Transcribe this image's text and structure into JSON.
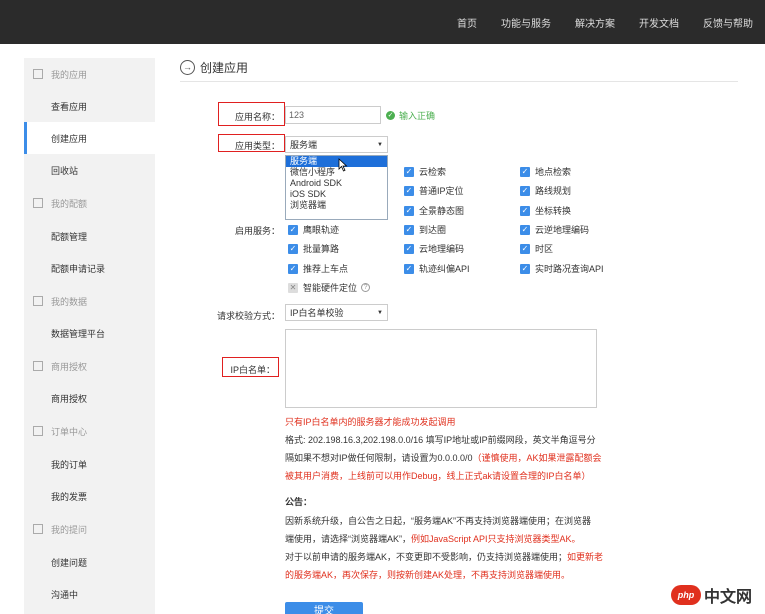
{
  "nav": {
    "items": [
      "首页",
      "功能与服务",
      "解决方案",
      "开发文档",
      "反馈与帮助"
    ]
  },
  "sidebar": {
    "sections": [
      {
        "head": "我的应用",
        "icon": "grid-icon",
        "items": [
          "查看应用",
          "创建应用",
          "回收站"
        ]
      },
      {
        "head": "我的配额",
        "icon": "list-icon",
        "items": [
          "配额管理",
          "配额申请记录"
        ]
      },
      {
        "head": "我的数据",
        "icon": "db-icon",
        "items": [
          "数据管理平台"
        ]
      },
      {
        "head": "商用授权",
        "icon": "lock-icon",
        "items": [
          "商用授权"
        ]
      },
      {
        "head": "订单中心",
        "icon": "list-icon",
        "items": [
          "我的订单",
          "我的发票"
        ]
      },
      {
        "head": "我的提问",
        "icon": "chat-icon",
        "items": [
          "创建问题",
          "沟通中"
        ]
      }
    ],
    "active": "创建应用"
  },
  "page": {
    "title": "创建应用"
  },
  "form": {
    "app_name_label": "应用名称：",
    "app_name_value": "123",
    "app_name_ok": "输入正确",
    "app_type_label": "应用类型：",
    "app_type_value": "服务端",
    "app_type_options": [
      "服务端",
      "微信小程序",
      "Android SDK",
      "iOS SDK",
      "浏览器端"
    ],
    "services_label": "启用服务：",
    "services": [
      [
        "云检索",
        "地点检索"
      ],
      [
        "普通IP定位",
        "路线规划"
      ],
      [
        "全景静态图",
        "坐标转换"
      ],
      [
        "鹰眼轨迹",
        "到达圈",
        "云逆地理编码"
      ],
      [
        "批量算路",
        "云地理编码",
        "时区"
      ],
      [
        "推荐上车点",
        "轨迹纠偏API",
        "实时路况查询API"
      ]
    ],
    "disabled_service": "智能硬件定位",
    "verify_label": "请求校验方式：",
    "verify_value": "IP白名单校验",
    "ip_label": "IP白名单：",
    "ip_note": "只有IP白名单内的服务器才能成功发起调用",
    "format_1": "格式: 202.198.16.3,202.198.0.0/16 填写IP地址或IP前缀网段，英文半角逗号分",
    "format_2a": "隔如果不想对IP做任何限制，请设置为0.0.0.0/0",
    "format_2b": "（谨慎使用，AK如果泄露配额会",
    "format_3": "被其用户消费，上线前可以用作Debug，线上正式ak请设置合理的IP白名单）",
    "notice_title": "公告：",
    "notice_1": "因新系统升级，自公告之日起，“服务端AK”不再支持浏览器端使用；在浏览器",
    "notice_2a": "端使用，请选择“浏览器端AK”，",
    "notice_2b": "例如JavaScript API只支持浏览器类型AK。",
    "notice_3a": "对于以前申请的服务端AK，不变更即不受影响，仍支持浏览器端使用；",
    "notice_3b": "如更新老",
    "notice_4": "的服务端AK，再次保存，则按新创建AK处理，不再支持浏览器端使用。",
    "submit": "提交"
  },
  "watermark": {
    "logo": "php",
    "text": "中文网"
  }
}
